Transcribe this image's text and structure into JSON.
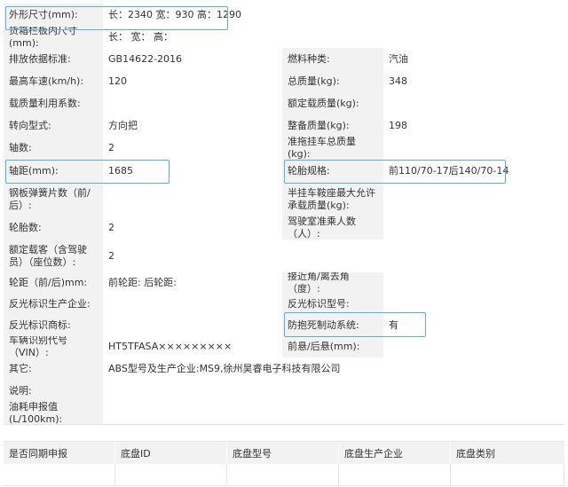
{
  "spec_rows": [
    {
      "label": "外形尺寸(mm):",
      "value": "长：2340 宽：930 高：1290"
    },
    {
      "label": "货箱栏板内尺寸(mm):",
      "value": "长：  宽：  高："
    },
    {
      "label": "排放依据标准:",
      "value": "GB14622-2016",
      "label2": "燃料种类:",
      "value2": "汽油"
    },
    {
      "label": "最高车速(km/h):",
      "value": "120",
      "label2": "总质量(kg):",
      "value2": "348"
    },
    {
      "label": "载质量利用系数:",
      "value": "",
      "label2": "额定载质量(kg):",
      "value2": ""
    },
    {
      "label": "转向型式:",
      "value": "方向把",
      "label2": "整备质量(kg):",
      "value2": "198"
    },
    {
      "label": "轴数:",
      "value": "2",
      "label2": "准拖挂车总质量(kg):",
      "value2": ""
    },
    {
      "label": "轴距(mm):",
      "value": "1685",
      "label2": "轮胎规格:",
      "value2": "前110/70-17后140/70-14"
    },
    {
      "label": "钢板弹簧片数（前/后）:",
      "value": "",
      "label2": "半挂车鞍座最大允许承载质量(kg):",
      "value2": ""
    },
    {
      "label": "轮胎数:",
      "value": "2",
      "label2": "驾驶室准乘人数（人）:",
      "value2": ""
    },
    {
      "label": "额定载客（含驾驶员）（座位数）:",
      "value": "2"
    },
    {
      "label": "轮距（前/后)mm:",
      "value": "前轮距: 后轮距:",
      "label2": "接近角/离去角（度）:",
      "value2": ""
    },
    {
      "label": "反光标识生产企业:",
      "value": "",
      "label2": "反光标识型号:",
      "value2": ""
    },
    {
      "label": "反光标识商标:",
      "value": "",
      "label2": "防抱死制动系统:",
      "value2": "有"
    },
    {
      "label": "车辆识别代号（VIN）:",
      "value": "HT5TFASA×××××××××",
      "label2": "前悬/后悬(mm):",
      "value2": ""
    },
    {
      "label": "其它:",
      "value": "ABS型号及生产企业:MS9,徐州昊睿电子科技有限公司"
    },
    {
      "label": "说明:",
      "value": ""
    },
    {
      "label": "油耗申报值(L/100km):",
      "value": ""
    }
  ],
  "chassis_table": {
    "headers": [
      "是否同期申报",
      "底盘ID",
      "底盘型号",
      "底盘生产企业",
      "底盘类别"
    ],
    "row": [
      "",
      "",
      "",
      "",
      ""
    ]
  }
}
